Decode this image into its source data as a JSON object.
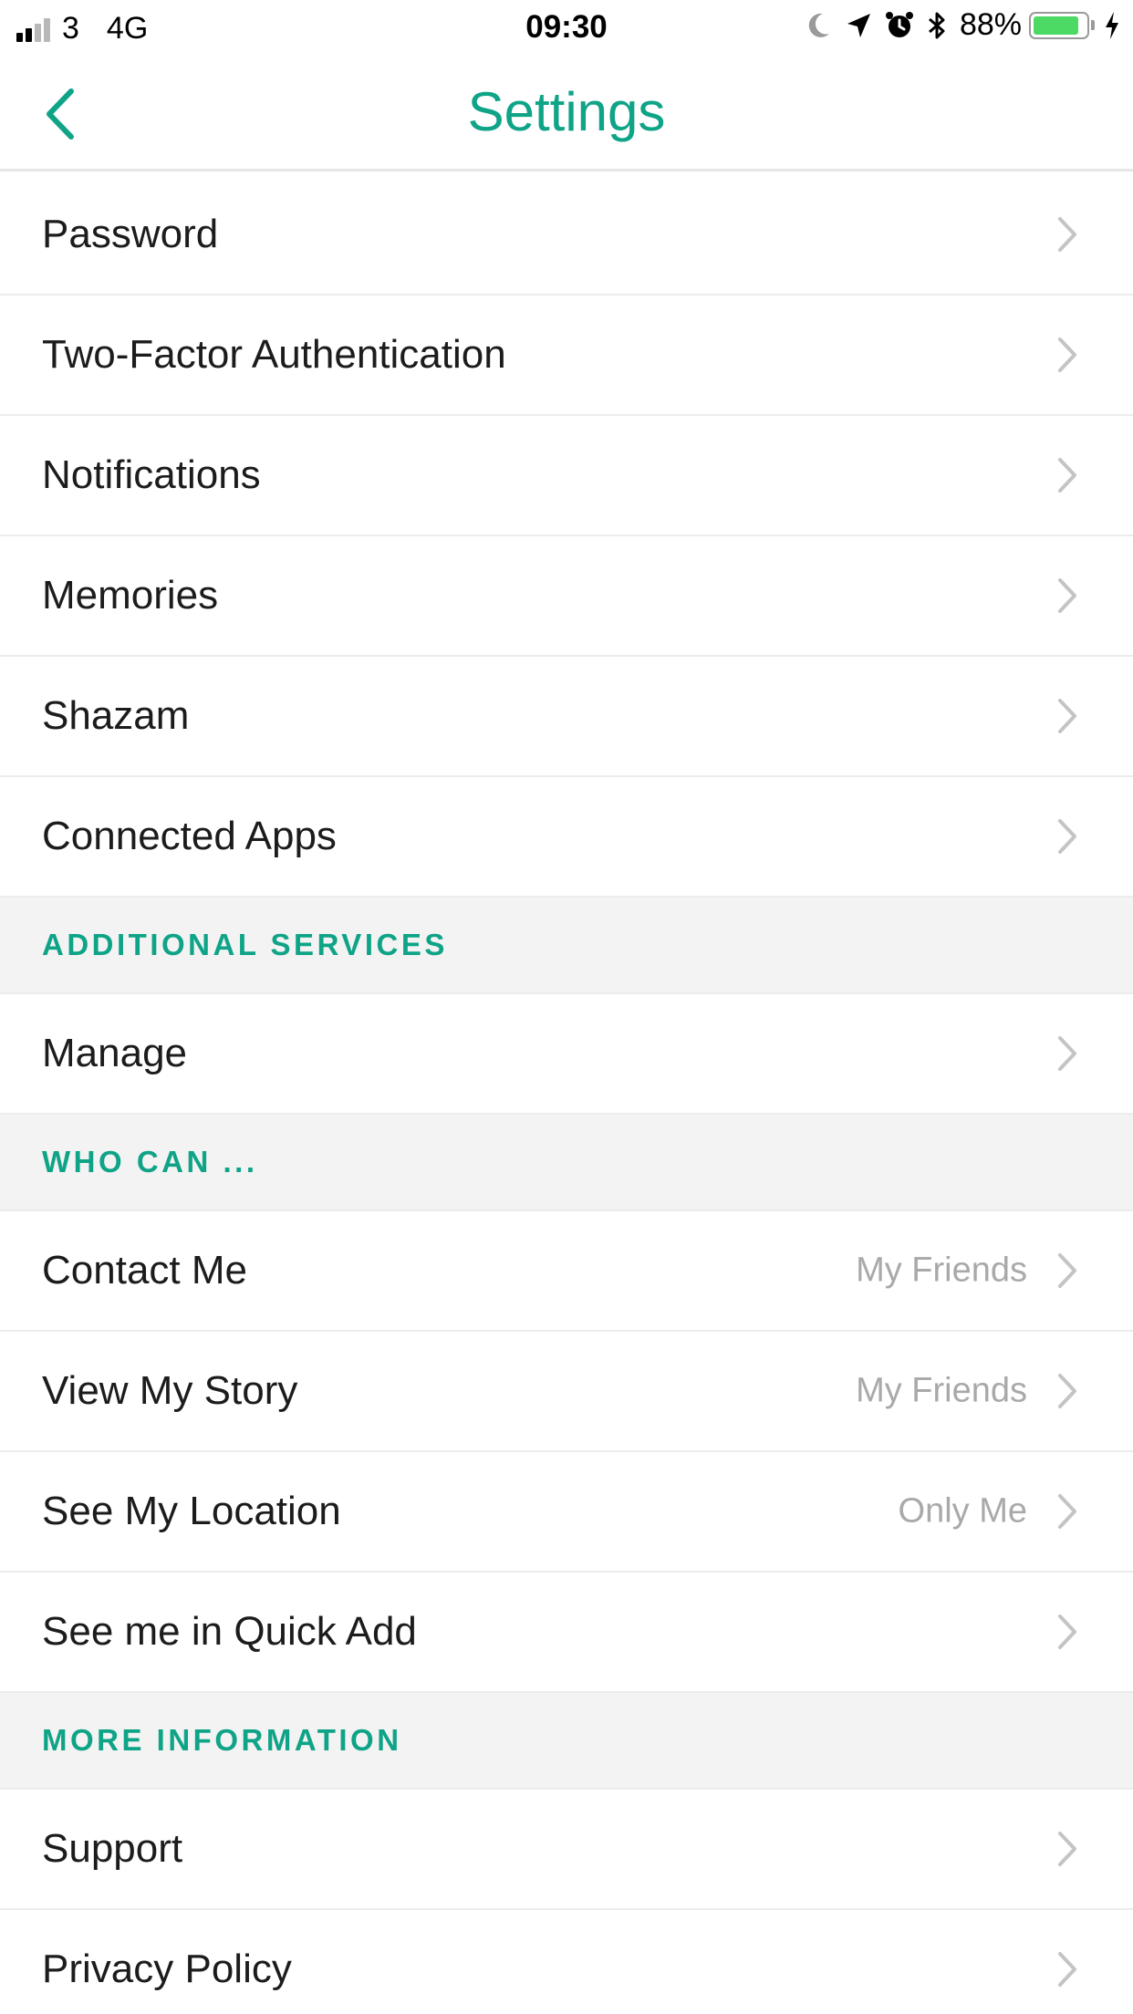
{
  "status_bar": {
    "carrier": "3",
    "network": "4G",
    "time": "09:30",
    "battery_percent_label": "88%",
    "battery_level": 0.88,
    "icons": [
      "moon-icon",
      "location-arrow-icon",
      "alarm-icon",
      "bluetooth-icon",
      "battery-icon",
      "charging-bolt-icon"
    ]
  },
  "nav": {
    "title": "Settings",
    "back_icon": "chevron-left-icon"
  },
  "colors": {
    "accent": "#0fa487",
    "section_bg": "#f3f3f3",
    "divider": "#ececec",
    "secondary_text": "#a9a9a9",
    "battery_green": "#4cd964"
  },
  "rows_group_1": [
    {
      "label": "Password"
    },
    {
      "label": "Two-Factor Authentication"
    },
    {
      "label": "Notifications"
    },
    {
      "label": "Memories"
    },
    {
      "label": "Shazam"
    },
    {
      "label": "Connected Apps"
    }
  ],
  "section_additional": {
    "title": "ADDITIONAL SERVICES",
    "rows": [
      {
        "label": "Manage"
      }
    ]
  },
  "section_who_can": {
    "title": "WHO CAN ...",
    "rows": [
      {
        "label": "Contact Me",
        "value": "My Friends"
      },
      {
        "label": "View My Story",
        "value": "My Friends"
      },
      {
        "label": "See My Location",
        "value": "Only Me"
      },
      {
        "label": "See me in Quick Add"
      }
    ]
  },
  "section_more_info": {
    "title": "MORE INFORMATION",
    "rows": [
      {
        "label": "Support"
      },
      {
        "label": "Privacy Policy"
      }
    ]
  }
}
